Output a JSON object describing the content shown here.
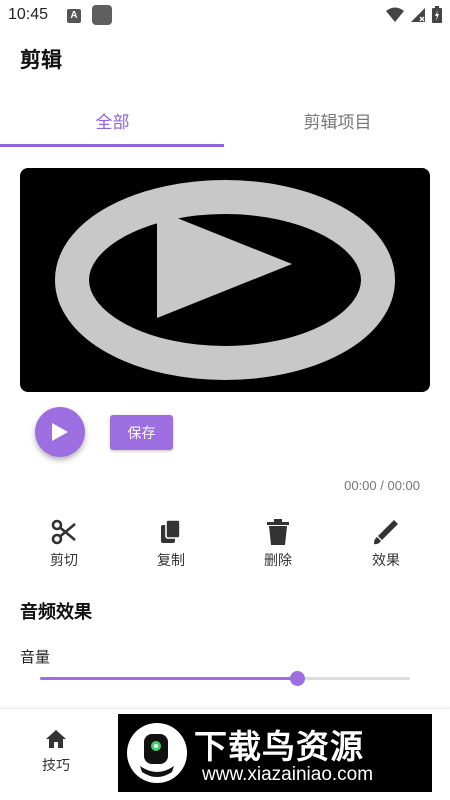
{
  "status_bar": {
    "time": "10:45",
    "notification_letter": "A",
    "icons": [
      "wifi-icon",
      "signal-icon",
      "battery-icon"
    ]
  },
  "page": {
    "title": "剪辑"
  },
  "tabs": [
    {
      "label": "全部",
      "active": true
    },
    {
      "label": "剪辑项目",
      "active": false
    }
  ],
  "player": {
    "save_label": "保存",
    "time_display": "00:00 / 00:00"
  },
  "actions": [
    {
      "label": "剪切",
      "icon": "scissors-icon"
    },
    {
      "label": "复制",
      "icon": "copy-icon"
    },
    {
      "label": "删除",
      "icon": "trash-icon"
    },
    {
      "label": "效果",
      "icon": "brush-icon"
    }
  ],
  "audio": {
    "section_title": "音频效果",
    "volume_label": "音量",
    "volume_value": 0.695
  },
  "bottom_nav": {
    "items": [
      {
        "label": "技巧",
        "icon": "home-icon"
      }
    ]
  },
  "watermark": {
    "title": "下载鸟资源",
    "url": "www.xiazainiao.com"
  },
  "colors": {
    "accent": "#9d6ee0",
    "tab_active": "#9064d8"
  }
}
